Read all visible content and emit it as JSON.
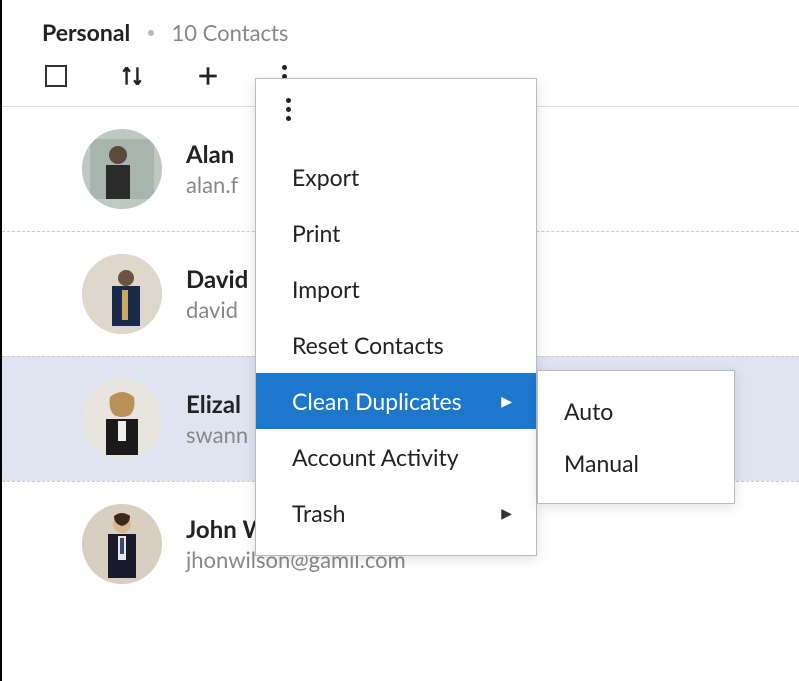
{
  "header": {
    "title": "Personal",
    "subtitle": "10 Contacts"
  },
  "contacts": [
    {
      "name": "Alan",
      "email": "alan.f",
      "selected": false
    },
    {
      "name": "David",
      "email": "david",
      "selected": false
    },
    {
      "name": "Elizal",
      "email": "swann",
      "selected": true
    },
    {
      "name": "John Wilson",
      "email": "jhonwilson@gamil.com",
      "selected": false
    }
  ],
  "menu": {
    "items": [
      {
        "label": "Export",
        "submenu": false,
        "highlighted": false
      },
      {
        "label": "Print",
        "submenu": false,
        "highlighted": false
      },
      {
        "label": "Import",
        "submenu": false,
        "highlighted": false
      },
      {
        "label": "Reset Contacts",
        "submenu": false,
        "highlighted": false
      },
      {
        "label": "Clean Duplicates",
        "submenu": true,
        "highlighted": true
      },
      {
        "label": "Account Activity",
        "submenu": false,
        "highlighted": false
      },
      {
        "label": "Trash",
        "submenu": true,
        "highlighted": false
      }
    ]
  },
  "submenu": {
    "items": [
      {
        "label": "Auto"
      },
      {
        "label": "Manual"
      }
    ]
  }
}
